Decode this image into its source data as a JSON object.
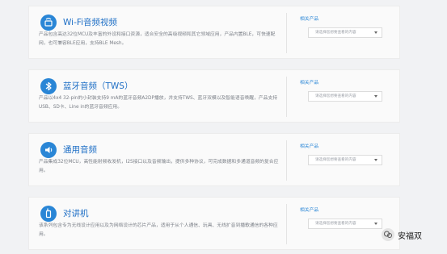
{
  "colors": {
    "accent": "#2a86d6",
    "title": "#1d6ec5",
    "text": "#7c8088"
  },
  "cards": [
    {
      "icon": "wifi-audio-icon",
      "title": "Wi-Fi音频视频",
      "desc": "产品包含高达32位MCU及丰富的外设和接口资源，适合安全的高级视频和其它领域应用，产品内置BLE，可快速配网，也可兼容BLE应用，支持BLE Mesh。",
      "related_label": "相关产品",
      "select_value": "请选择您想要查看的内容"
    },
    {
      "icon": "bluetooth-audio-icon",
      "title": "蓝牙音频（TWS）",
      "desc": "产品以4x4 32-pin的小封装支持9 mA的蓝牙音频A2DP播放，并支持TWS、蓝牙双模以及智能语音唤醒，产品支持USB、SD卡、Line in的蓝牙音频应用。",
      "related_label": "相关产品",
      "select_value": "请选择您想要查看的内容"
    },
    {
      "icon": "general-audio-icon",
      "title": "通用音频",
      "desc": "产品集成32位MCU，高性能射频收发机，I2S接口以及音频输出，提供多种协议，可完成数据和多通道音频的复合应用。",
      "related_label": "相关产品",
      "select_value": "请选择您想要查看的内容"
    },
    {
      "icon": "intercom-icon",
      "title": "对讲机",
      "desc": "该系列包含专为无线设计应用以及为网络设计的芯片产品，适用于从个人通信、玩具、无线扩音到播歌通信的各种应用。",
      "related_label": "相关产品",
      "select_value": "请选择您想要查看的内容"
    }
  ],
  "watermark": {
    "text": "安福双"
  }
}
